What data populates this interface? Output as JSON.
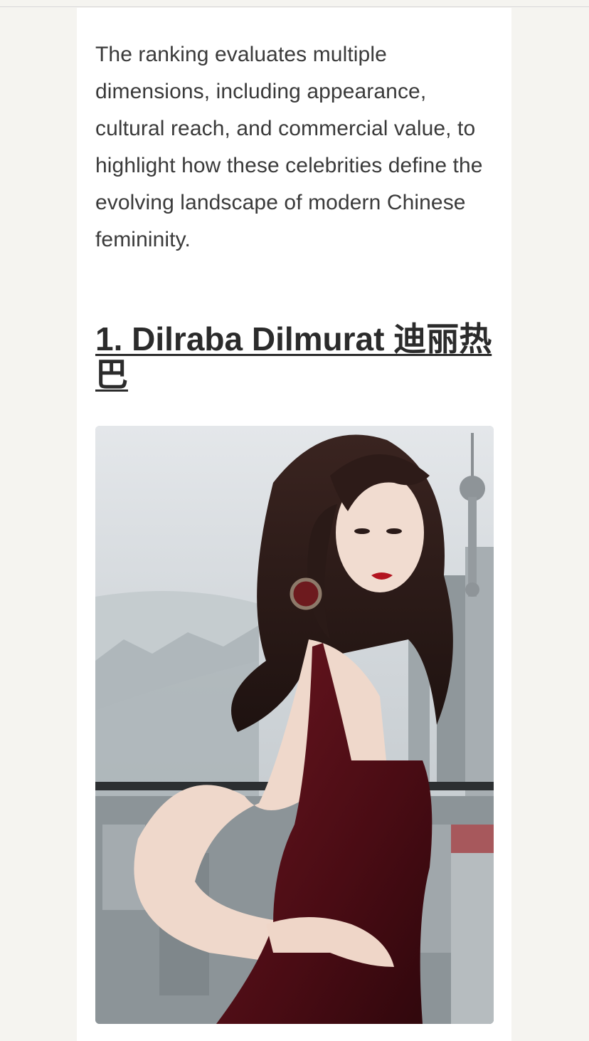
{
  "article": {
    "intro_text": "The ranking evaluates multiple dimensions, including appearance, cultural reach, and commercial value, to highlight how these celebrities define the evolving landscape of modern Chinese femininity.",
    "heading": "1. Dilraba Dilmurat 迪丽热巴"
  },
  "photo": {
    "subject": "woman-in-red-velvet-dress",
    "background": "city-skyline-with-tower",
    "colors": {
      "sky": "#d6dadd",
      "city": "#9aa2a6",
      "dress": "#5a0f17",
      "hair": "#2a1a18",
      "skin": "#efd9cc"
    }
  }
}
